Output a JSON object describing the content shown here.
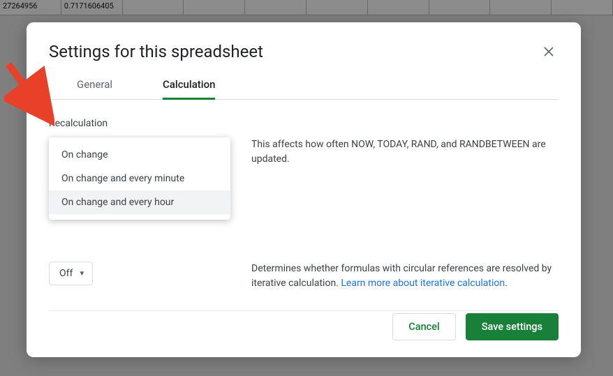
{
  "background_cells": [
    "27264956",
    "0.7171606405"
  ],
  "dialog": {
    "title": "Settings for this spreadsheet",
    "tabs": {
      "general": "General",
      "calculation": "Calculation"
    },
    "recalc": {
      "label": "Recalculation",
      "options": {
        "on_change": "On change",
        "every_minute": "On change and every minute",
        "every_hour": "On change and every hour"
      },
      "help": "This affects how often NOW, TODAY, RAND, and RANDBETWEEN are updated."
    },
    "iterative": {
      "selected": "Off",
      "help_prefix": "Determines whether formulas with circular references are resolved by iterative calculation. ",
      "link_text": "Learn more about iterative calculation",
      "help_suffix": "."
    },
    "buttons": {
      "cancel": "Cancel",
      "save": "Save settings"
    }
  }
}
